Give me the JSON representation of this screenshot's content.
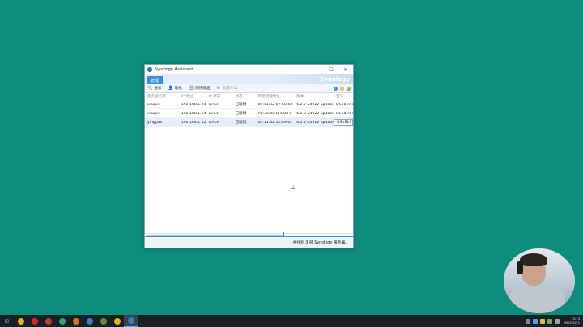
{
  "window": {
    "title": "Synology Assistant",
    "min_glyph": "—",
    "max_glyph": "☐",
    "close_glyph": "✕",
    "brand": "Synology"
  },
  "tabs": [
    {
      "label": "管理"
    }
  ],
  "toolbar": {
    "items": [
      {
        "label": "搜索",
        "icon": "search-icon",
        "glyph": "🔍"
      },
      {
        "label": "联机",
        "icon": "user-icon",
        "glyph": "👤"
      },
      {
        "label": "网络硬盘",
        "icon": "drive-icon",
        "glyph": "🗄"
      },
      {
        "label": "设置WOL",
        "icon": "power-icon",
        "glyph": "⚙"
      }
    ],
    "right_icons": [
      {
        "name": "help-icon",
        "glyph": "?"
      },
      {
        "name": "feedback-icon",
        "glyph": "☺"
      },
      {
        "name": "settings-icon",
        "glyph": "⚙"
      }
    ]
  },
  "table": {
    "columns": [
      "服务器名称",
      "IP 地址",
      "IP 状态",
      "状态",
      "网络物理地址",
      "版本",
      "型号"
    ],
    "rows": [
      {
        "name": "xiaojie",
        "ip": "192.168.1.242",
        "ip_status": "DHCP",
        "status": "已就绪",
        "mac": "00:11:32:57:60:58",
        "version": "6.2.2-24922 update 4",
        "model": "DS1819+"
      },
      {
        "name": "xiaojie",
        "ip": "192.168.1.64",
        "ip_status": "DHCP",
        "status": "已就绪",
        "mac": "A0:36:9F:1F:B0:F4",
        "version": "6.2.2-24922 update 4",
        "model": "DS1819+"
      },
      {
        "name": "yingpan",
        "ip": "192.168.1.120",
        "ip_status": "DHCP",
        "status": "已就绪",
        "mac": "00:11:32:50:89:61",
        "version": "6.2.2-24922 update 3",
        "model": "DS1819+"
      }
    ]
  },
  "statusbar": {
    "text": "共找到 3 部 Synology 服务器。"
  },
  "taskbar": {
    "apps": [
      {
        "name": "start-button",
        "glyph": "⊞",
        "color": "#4aa3e0"
      },
      {
        "name": "chrome-icon",
        "color": "#e8b02a"
      },
      {
        "name": "netease-music-icon",
        "color": "#d8232a"
      },
      {
        "name": "app-icon-3",
        "color": "#c23b2e"
      },
      {
        "name": "app-icon-4",
        "color": "#2aa879"
      },
      {
        "name": "firefox-icon",
        "color": "#e66a2c"
      },
      {
        "name": "app-icon-6",
        "color": "#3a7bd5"
      },
      {
        "name": "app-icon-7",
        "color": "#5a8f3a"
      },
      {
        "name": "chrome-icon-2",
        "color": "#e8b02a"
      },
      {
        "name": "synology-assistant-taskbar-icon",
        "color": "#2d7fc4"
      }
    ],
    "clock_time": "13:13",
    "clock_date": "2021/2/21"
  }
}
